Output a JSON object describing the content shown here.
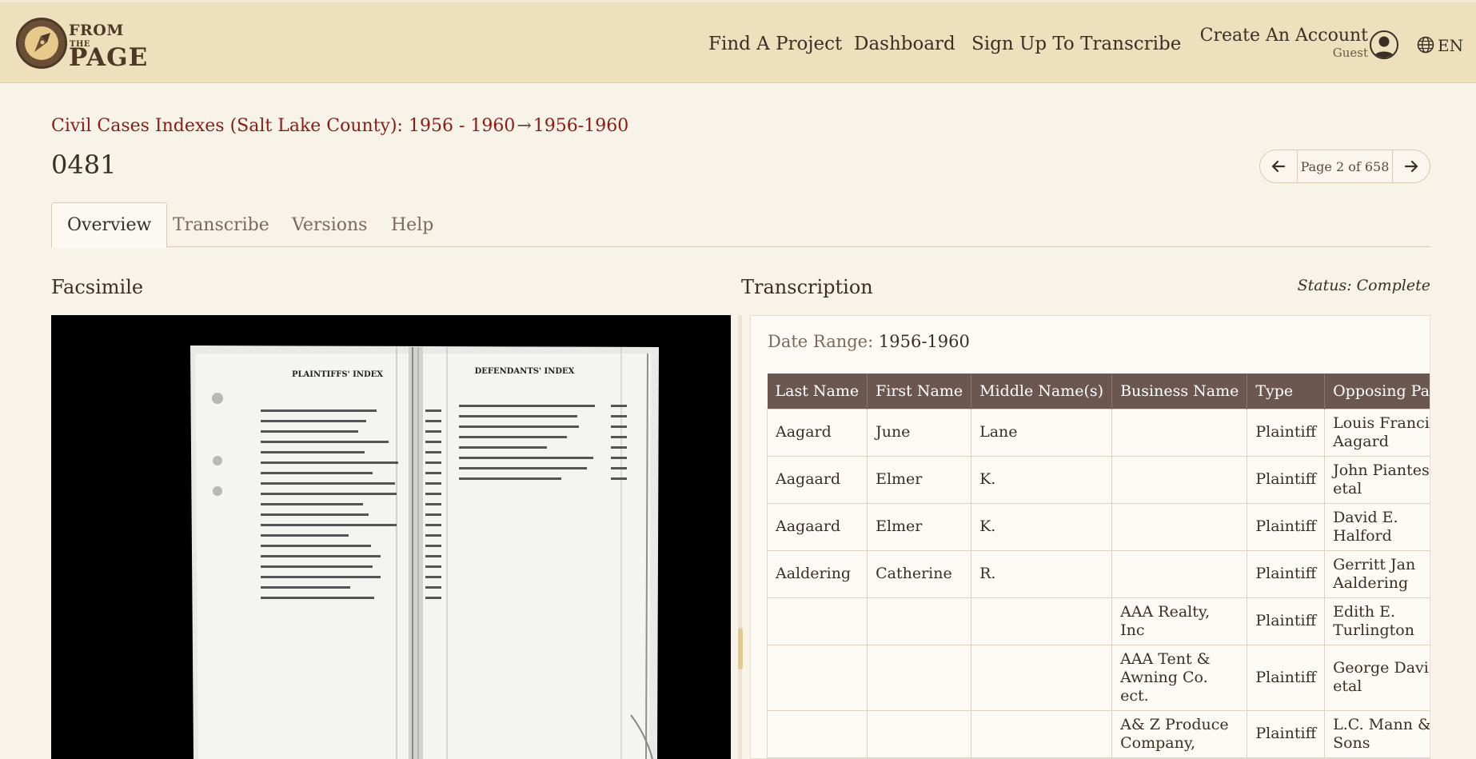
{
  "header": {
    "logo": {
      "from": "FROM",
      "the": "THE",
      "page": "PAGE"
    },
    "nav": [
      "Find A Project",
      "Dashboard",
      "Sign Up To Transcribe"
    ],
    "account": {
      "title": "Create An Account",
      "subtitle": "Guest"
    },
    "language": "EN"
  },
  "breadcrumb": {
    "collection": "Civil Cases Indexes (Salt Lake County): 1956 - 1960",
    "arrow": "→",
    "work": "1956-1960"
  },
  "page_title": "0481",
  "pager": {
    "text": "Page 2 of 658"
  },
  "tabs": [
    "Overview",
    "Transcribe",
    "Versions",
    "Help"
  ],
  "facsimile": {
    "heading": "Facsimile",
    "left_heading": "PLAINTIFFS' INDEX",
    "right_heading": "DEFENDANTS' INDEX"
  },
  "transcription": {
    "heading": "Transcription",
    "status": "Status: Complete",
    "date_range_label": "Date Range:",
    "date_range_value": "1956-1960",
    "columns": [
      "Last Name",
      "First Name",
      "Middle Name(s)",
      "Business Name",
      "Type",
      "Opposing Party"
    ],
    "rows": [
      [
        "Aagard",
        "June",
        "Lane",
        "",
        "Plaintiff",
        "Louis Francis Aagard"
      ],
      [
        "Aagaard",
        "Elmer",
        "K.",
        "",
        "Plaintiff",
        "John Piantes, etal"
      ],
      [
        "Aagaard",
        "Elmer",
        "K.",
        "",
        "Plaintiff",
        "David E. Halford"
      ],
      [
        "Aaldering",
        "Catherine",
        "R.",
        "",
        "Plaintiff",
        "Gerritt Jan Aaldering"
      ],
      [
        "",
        "",
        "",
        "AAA Realty, Inc",
        "Plaintiff",
        "Edith E. Turlington"
      ],
      [
        "",
        "",
        "",
        "AAA Tent & Awning Co. ect.",
        "Plaintiff",
        "George David, etal"
      ],
      [
        "",
        "",
        "",
        "A& Z Produce Company,",
        "Plaintiff",
        "L.C. Mann & Sons"
      ]
    ]
  }
}
